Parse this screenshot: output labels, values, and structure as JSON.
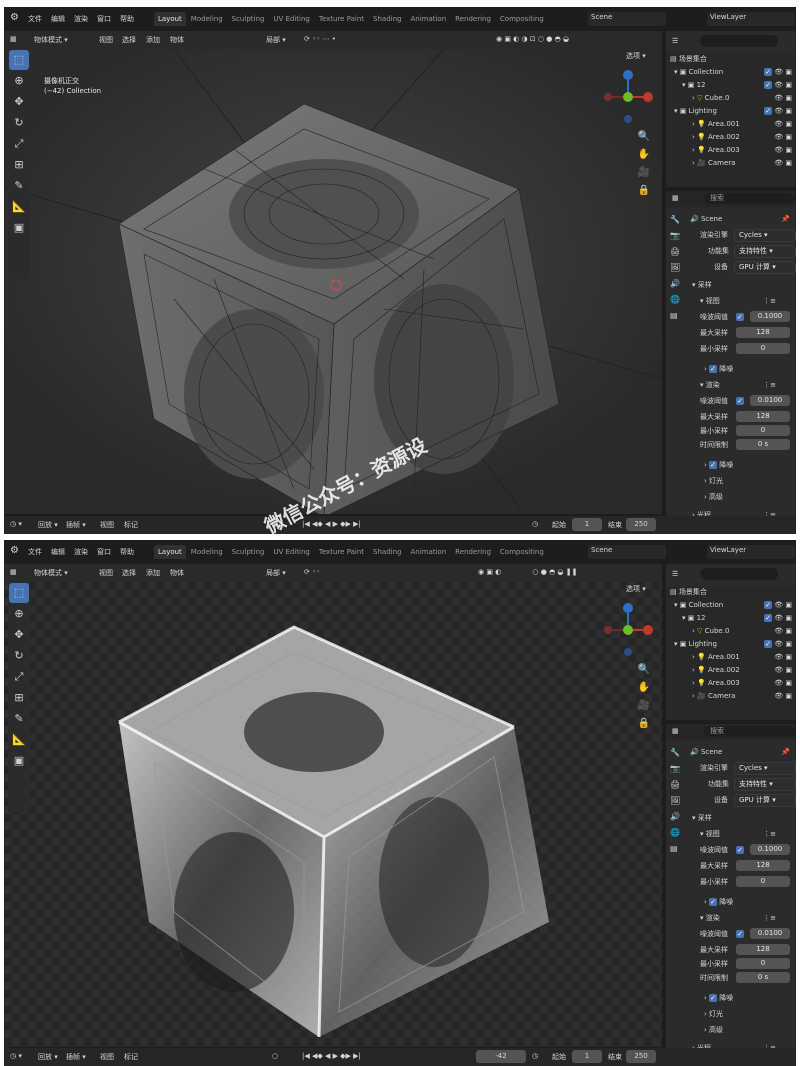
{
  "menu": [
    "文件",
    "编辑",
    "渲染",
    "窗口",
    "帮助"
  ],
  "tabs": [
    "Layout",
    "Modeling",
    "Sculpting",
    "UV Editing",
    "Texture Paint",
    "Shading",
    "Animation",
    "Rendering",
    "Compositing"
  ],
  "scene_name": "Scene",
  "view_layer": "ViewLayer",
  "mode": "物体模式",
  "header_menus": [
    "视图",
    "选择",
    "添加",
    "物体"
  ],
  "transform": "局部",
  "options": "选项",
  "overlay_title": "摄像机正交",
  "overlay_sub": "(−42) Collection",
  "outliner": {
    "root": "场景集合",
    "collection": "Collection",
    "group12": "12",
    "cube": "Cube.0",
    "lighting": "Lighting",
    "area1": "Area.001",
    "area2": "Area.002",
    "area3": "Area.003",
    "camera": "Camera"
  },
  "search_placeholder": "搜索",
  "props": {
    "scene": "Scene",
    "engine_label": "渲染引擎",
    "engine": "Cycles",
    "feature_label": "功能集",
    "feature": "支持特性",
    "device_label": "设备",
    "device": "GPU 计算",
    "sampling": "采样",
    "viewport": "视图",
    "noise_thresh_label": "噪波阈值",
    "vp_noise": "0.1000",
    "max_samples_label": "最大采样",
    "vp_max": "128",
    "min_samples_label": "最小采样",
    "vp_min": "0",
    "denoise": "降噪",
    "render": "渲染",
    "r_noise": "0.0100",
    "r_max": "128",
    "r_min": "0",
    "time_limit_label": "时间限制",
    "r_time": "0 s",
    "lights": "灯光",
    "advanced": "高级",
    "light_paths": "光程"
  },
  "timeline": {
    "playback": "回放",
    "keying": "插帧",
    "view": "视图",
    "marker": "标记",
    "current_frame": "-42",
    "start_label": "起始",
    "start": "1",
    "end_label": "结束",
    "end": "250"
  },
  "watermark": "微信公众号：资源设",
  "colors": {
    "accent": "#4772b3",
    "bg": "#1d1d1d",
    "x_axis": "#c0392b",
    "y_axis": "#6dbd26",
    "z_axis": "#2f6fc6"
  }
}
